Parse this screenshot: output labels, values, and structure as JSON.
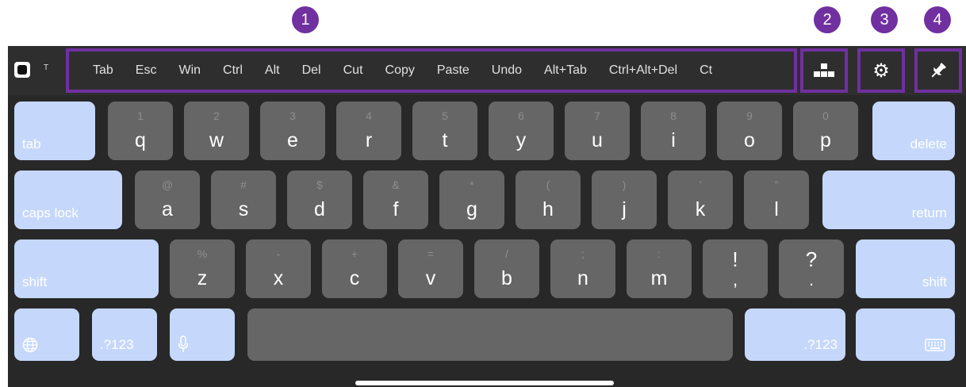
{
  "annotations": [
    "1",
    "2",
    "3",
    "4"
  ],
  "toolbar": {
    "t_label": "T",
    "shortcuts": [
      "Tab",
      "Esc",
      "Win",
      "Ctrl",
      "Alt",
      "Del",
      "Cut",
      "Copy",
      "Paste",
      "Undo",
      "Alt+Tab",
      "Ctrl+Alt+Del",
      "Ct"
    ],
    "icons": {
      "layout": "keyboard-layout-icon",
      "settings": "gear-icon",
      "pin": "pin-icon"
    }
  },
  "rows": {
    "r1": {
      "keys": [
        {
          "main": "q",
          "sub": "1"
        },
        {
          "main": "w",
          "sub": "2"
        },
        {
          "main": "e",
          "sub": "3"
        },
        {
          "main": "r",
          "sub": "4"
        },
        {
          "main": "t",
          "sub": "5"
        },
        {
          "main": "y",
          "sub": "6"
        },
        {
          "main": "u",
          "sub": "7"
        },
        {
          "main": "i",
          "sub": "8"
        },
        {
          "main": "o",
          "sub": "9"
        },
        {
          "main": "p",
          "sub": "0"
        }
      ],
      "tab": "tab",
      "delete": "delete"
    },
    "r2": {
      "keys": [
        {
          "main": "a",
          "sub": "@"
        },
        {
          "main": "s",
          "sub": "#"
        },
        {
          "main": "d",
          "sub": "$"
        },
        {
          "main": "f",
          "sub": "&"
        },
        {
          "main": "g",
          "sub": "*"
        },
        {
          "main": "h",
          "sub": "("
        },
        {
          "main": "j",
          "sub": ")"
        },
        {
          "main": "k",
          "sub": "’"
        },
        {
          "main": "l",
          "sub": "”"
        }
      ],
      "caps": "caps lock",
      "return": "return"
    },
    "r3": {
      "keys": [
        {
          "main": "z",
          "sub": "%"
        },
        {
          "main": "x",
          "sub": "-"
        },
        {
          "main": "c",
          "sub": "+"
        },
        {
          "main": "v",
          "sub": "="
        },
        {
          "main": "b",
          "sub": "/"
        },
        {
          "main": "n",
          "sub": ";"
        },
        {
          "main": "m",
          "sub": ":"
        }
      ],
      "punct1": {
        "top": "!",
        "bottom": ","
      },
      "punct2": {
        "top": "?",
        "bottom": "."
      },
      "shift_left": "shift",
      "shift_right": "shift"
    },
    "r4": {
      "num_left": ".?123",
      "num_right": ".?123",
      "icons": {
        "globe": "globe-icon",
        "mic": "microphone-icon",
        "hide": "keyboard-hide-icon"
      }
    }
  }
}
